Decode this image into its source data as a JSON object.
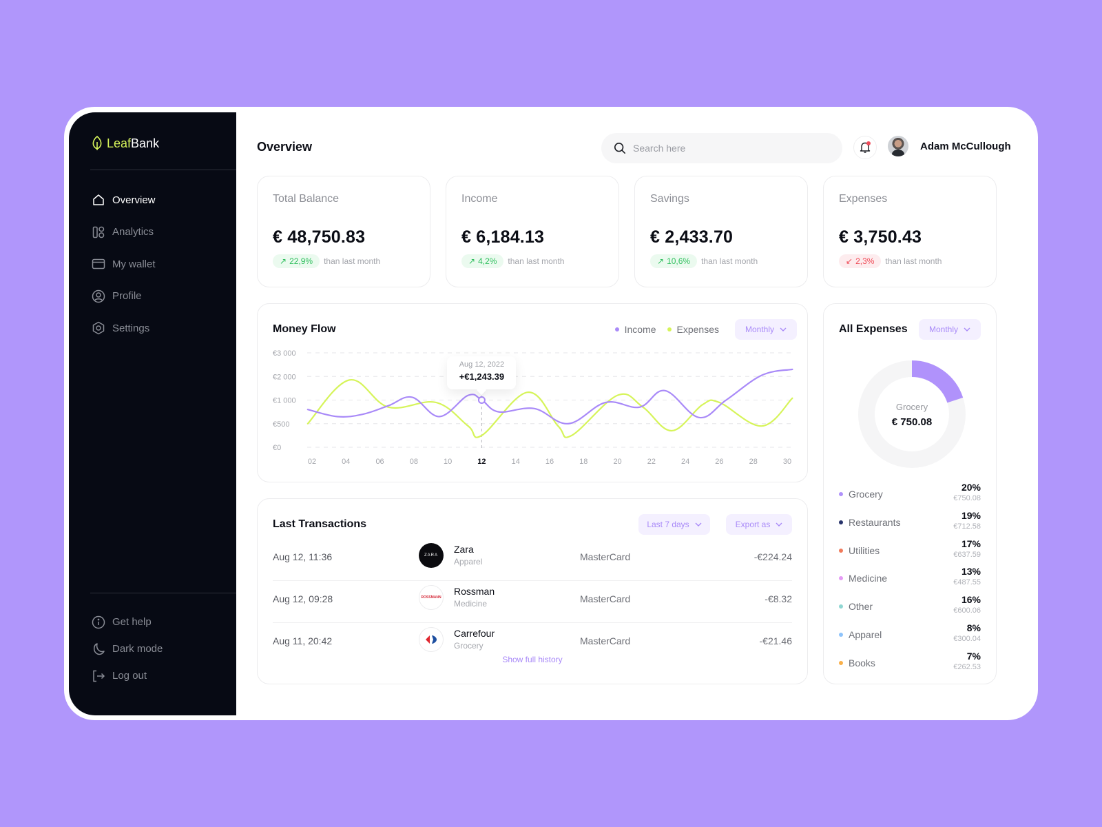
{
  "app": {
    "brand_leaf": "Leaf",
    "brand_bank": "Bank",
    "colors": {
      "accent": "#b092fb",
      "lime": "#d6f45a",
      "sidebar_bg": "#070a14",
      "up": "#2fbf5d",
      "down": "#ef4b57"
    }
  },
  "sidebar": {
    "items": [
      {
        "label": "Overview",
        "icon": "home-icon",
        "active": true
      },
      {
        "label": "Analytics",
        "icon": "analytics-icon",
        "active": false
      },
      {
        "label": "My wallet",
        "icon": "wallet-icon",
        "active": false
      },
      {
        "label": "Profile",
        "icon": "profile-icon",
        "active": false
      },
      {
        "label": "Settings",
        "icon": "settings-icon",
        "active": false
      }
    ],
    "bottom_items": [
      {
        "label": "Get help",
        "icon": "info-icon"
      },
      {
        "label": "Dark mode",
        "icon": "moon-icon"
      },
      {
        "label": "Log out",
        "icon": "logout-icon"
      }
    ]
  },
  "header": {
    "title": "Overview",
    "search_placeholder": "Search here",
    "user_name": "Adam McCullough",
    "has_notification": true
  },
  "stats": [
    {
      "label": "Total Balance",
      "value": "€ 48,750.83",
      "change": "22,9%",
      "direction": "up",
      "note": "than last month"
    },
    {
      "label": "Income",
      "value": "€ 6,184.13",
      "change": "4,2%",
      "direction": "up",
      "note": "than last month"
    },
    {
      "label": "Savings",
      "value": "€ 2,433.70",
      "change": "10,6%",
      "direction": "up",
      "note": "than last month"
    },
    {
      "label": "Expenses",
      "value": "€ 3,750.43",
      "change": "2,3%",
      "direction": "down",
      "note": "than last month"
    }
  ],
  "money_flow": {
    "title": "Money Flow",
    "period": "Monthly",
    "tooltip": {
      "date": "Aug 12, 2022",
      "value": "+€1,243.39",
      "day": 12
    }
  },
  "chart_data": {
    "type": "line",
    "title": "Money Flow",
    "xlabel": "",
    "ylabel": "",
    "y_ticks": [
      0,
      500,
      1000,
      2000,
      3000
    ],
    "y_tick_labels": [
      "€0",
      "€500",
      "€1 000",
      "€2 000",
      "€3 000"
    ],
    "x_ticks": [
      2,
      4,
      6,
      8,
      10,
      12,
      14,
      16,
      18,
      20,
      22,
      24,
      26,
      28,
      30
    ],
    "x_tick_labels": [
      "02",
      "04",
      "06",
      "08",
      "10",
      "12",
      "14",
      "16",
      "18",
      "20",
      "22",
      "24",
      "26",
      "28",
      "30"
    ],
    "highlight_x": 12,
    "xlim": [
      1.75,
      30.3
    ],
    "ylim": [
      0,
      3000
    ],
    "grid": true,
    "legend": "top-right",
    "series": [
      {
        "name": "Income",
        "color": "#a98af8",
        "x": [
          1.75,
          3.5,
          5,
          6.5,
          7.9,
          9.5,
          11.2,
          12,
          13,
          15.1,
          17.1,
          19.3,
          21.3,
          22.8,
          24.8,
          26.4,
          28.5,
          30.3
        ],
        "y": [
          800,
          650,
          700,
          880,
          1120,
          650,
          1200,
          1000,
          750,
          820,
          500,
          950,
          850,
          1400,
          630,
          1000,
          2050,
          2300
        ]
      },
      {
        "name": "Expenses",
        "color": "#d6f45a",
        "x": [
          1.75,
          4.2,
          6.5,
          9.3,
          11.2,
          12,
          14.7,
          16.5,
          17.3,
          20,
          21.5,
          23.2,
          25,
          26,
          28.5,
          30.3
        ],
        "y": [
          500,
          1850,
          850,
          950,
          450,
          250,
          1330,
          450,
          250,
          1200,
          850,
          350,
          900,
          950,
          450,
          1080
        ]
      }
    ]
  },
  "transactions": {
    "title": "Last Transactions",
    "filter": "Last 7 days",
    "export": "Export as",
    "rows": [
      {
        "date": "Aug 12, 11:36",
        "name": "Zara",
        "category": "Apparel",
        "method": "MasterCard",
        "amount": "-€224.24",
        "logo": "ZARA"
      },
      {
        "date": "Aug 12, 09:28",
        "name": "Rossman",
        "category": "Medicine",
        "method": "MasterCard",
        "amount": "-€8.32",
        "logo": "ROSSMANN"
      },
      {
        "date": "Aug 11, 20:42",
        "name": "Carrefour",
        "category": "Grocery",
        "method": "MasterCard",
        "amount": "-€21.46",
        "logo": "carrefour"
      }
    ],
    "show_history": "Show full history"
  },
  "all_expenses": {
    "title": "All Expenses",
    "period": "Monthly",
    "center_label": "Grocery",
    "center_value": "€ 750.08",
    "highlight_fraction": 0.2,
    "items": [
      {
        "name": "Grocery",
        "pct": "20%",
        "amount": "€750.08",
        "color": "#b092fb"
      },
      {
        "name": "Restaurants",
        "pct": "19%",
        "amount": "€712.58",
        "color": "#27336b"
      },
      {
        "name": "Utilities",
        "pct": "17%",
        "amount": "€637.59",
        "color": "#f07a5b"
      },
      {
        "name": "Medicine",
        "pct": "13%",
        "amount": "€487.55",
        "color": "#e59bf5"
      },
      {
        "name": "Other",
        "pct": "16%",
        "amount": "€600.06",
        "color": "#8fd6d2"
      },
      {
        "name": "Apparel",
        "pct": "8%",
        "amount": "€300.04",
        "color": "#8ec3fb"
      },
      {
        "name": "Books",
        "pct": "7%",
        "amount": "€262.53",
        "color": "#f9b04a"
      }
    ]
  }
}
